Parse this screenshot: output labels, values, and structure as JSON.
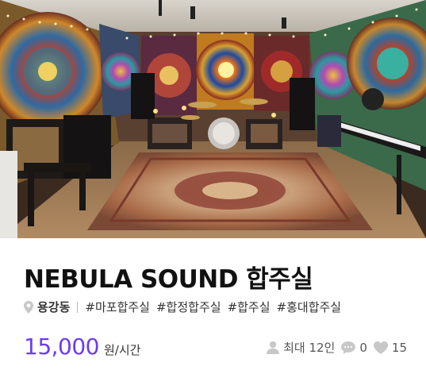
{
  "listing": {
    "title": "NEBULA SOUND 합주실",
    "location": "용강동",
    "tags": [
      "#마포합주실",
      "#합정합주실",
      "#합주실",
      "#홍대합주실"
    ],
    "price": "15,000",
    "price_unit": "원/시간",
    "capacity": "최대 12인",
    "comments": "0",
    "likes": "15"
  },
  "colors": {
    "accent": "#6a3df0",
    "icon_gray": "#c8c8c8"
  },
  "icons": [
    "location-pin-icon",
    "person-icon",
    "comment-icon",
    "heart-icon"
  ]
}
